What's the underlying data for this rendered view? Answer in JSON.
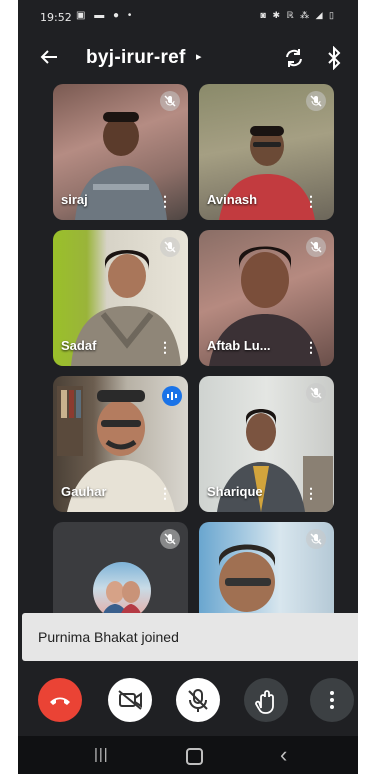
{
  "status_bar": {
    "time": "19:52",
    "left_icons": "▣ ▬ ●  •",
    "right_icons": "◙ ✱ ℝ ⁂ ◢ ▯"
  },
  "header": {
    "meeting_code": "byj-irur-ref",
    "icons": [
      "back-arrow-icon",
      "switch-camera-icon",
      "bluetooth-icon"
    ]
  },
  "participants": [
    {
      "name": "siraj",
      "muted": true
    },
    {
      "name": "Avinash",
      "muted": true
    },
    {
      "name": "Sadaf",
      "muted": true
    },
    {
      "name": "Aftab Lu...",
      "muted": true
    },
    {
      "name": "Gauhar",
      "muted": false,
      "speaking": true
    },
    {
      "name": "Sharique",
      "muted": true
    },
    {
      "name": "",
      "muted": true
    },
    {
      "name": "",
      "muted": true
    }
  ],
  "toast": {
    "text": "Purnima Bhakat joined"
  },
  "controls": [
    "end-call-icon",
    "camera-off-icon",
    "mic-off-icon",
    "raise-hand-icon",
    "more-vert-icon"
  ],
  "colors": {
    "background": "#1f2023",
    "end_call": "#ea4335",
    "speaking": "#1a73e8",
    "toast": "#e6e6e6"
  }
}
